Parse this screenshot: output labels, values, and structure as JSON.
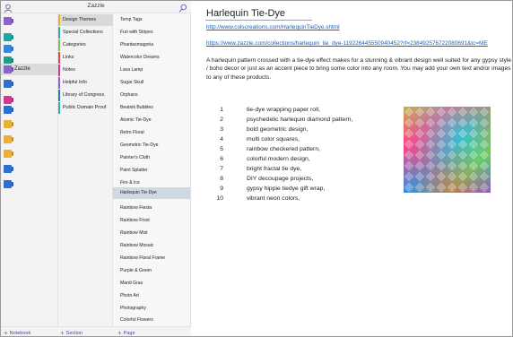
{
  "header": {
    "notebook_title": "Zazzle"
  },
  "colors": {
    "accent": "#7b51b5",
    "selected_page": "#cfd8e3"
  },
  "notebooks": [
    {
      "color": "#8b64c9",
      "label": ""
    },
    {
      "color": "#22a6a3",
      "label": ""
    },
    {
      "color": "#3a86d6",
      "label": ""
    },
    {
      "color": "#1f9e8c",
      "label": ""
    },
    {
      "color": "#8b64c9",
      "label": "Zazzle",
      "active": true
    },
    {
      "color": "#2f6fd0",
      "label": ""
    },
    {
      "color": "#d6368f",
      "label": ""
    },
    {
      "color": "#2f6fd0",
      "label": ""
    },
    {
      "color": "#e8b13a",
      "label": ""
    },
    {
      "color": "#e8b13a",
      "label": ""
    },
    {
      "color": "#e8b13a",
      "label": ""
    },
    {
      "color": "#2f6fd0",
      "label": ""
    },
    {
      "color": "#2f6fd0",
      "label": ""
    }
  ],
  "sections": [
    {
      "label": "Design Themes",
      "color": "#e8b13a",
      "active": true
    },
    {
      "label": "Special Collections",
      "color": "#2fb0a5"
    },
    {
      "label": "Categories",
      "color": "#7cc24a"
    },
    {
      "label": "Links",
      "color": "#e24444"
    },
    {
      "label": "Notes",
      "color": "#d6368f"
    },
    {
      "label": "Helpful Info",
      "color": "#8b64c9"
    },
    {
      "label": "Library of Congress",
      "color": "#2f6fd0"
    },
    {
      "label": "Public Domain Proof",
      "color": "#2fb0a5"
    }
  ],
  "pages": [
    {
      "label": "Temp Tags"
    },
    {
      "label": "Fun with Stripes"
    },
    {
      "label": "Phantasmagoria"
    },
    {
      "label": "Watercolor Dreams"
    },
    {
      "label": "Lava Lamp"
    },
    {
      "label": "Sugar Skull"
    },
    {
      "label": "Orphans"
    },
    {
      "label": "Beatnik Bubbles"
    },
    {
      "label": "Atomic Tie-Dye"
    },
    {
      "label": "Retro Floral"
    },
    {
      "label": "Geometric Tie-Dye"
    },
    {
      "label": "Painter's Cloth"
    },
    {
      "label": "Paint Splatter"
    },
    {
      "label": "Fire & Ice"
    },
    {
      "label": "Harlequin Tie-Dye",
      "active": true
    },
    {
      "label": "Rainbow Fiesta"
    },
    {
      "label": "Rainbow Frost"
    },
    {
      "label": "Rainbow Mist"
    },
    {
      "label": "Rainbow Mosaic"
    },
    {
      "label": "Rainbow Floral Frame"
    },
    {
      "label": "Purple & Green"
    },
    {
      "label": "Mardi Gras"
    },
    {
      "label": "Photo Art"
    },
    {
      "label": "Photography"
    },
    {
      "label": "Colorful Flowers"
    }
  ],
  "bottom": {
    "add_notebook": "Notebook",
    "add_section": "Section",
    "add_page": "Page"
  },
  "page": {
    "title": "Harlequin Tie-Dye",
    "link1": "http://www.colscreations.com/HarlequinTieDye.shtml",
    "link2": "https://www.zazzle.com/collections/harlequin_tie_dye-119226445550940452?rf=238492576722080691&tc=ME",
    "description": "A harlequin pattern crossed with a tie-dye effect makes for a stunning & vibrant design well suited for any gypsy style / boho decor or just as an accent piece to bring some color into any room. You may add your own text and/or images to any of these products.",
    "items": [
      {
        "num": "1",
        "text": "tie-dye wrapping paper roll,"
      },
      {
        "num": "2",
        "text": "psychedelic harlequin diamond pattern,"
      },
      {
        "num": "3",
        "text": "bold geometric design,"
      },
      {
        "num": "4",
        "text": "multi color squares,"
      },
      {
        "num": "5",
        "text": "rainbow checkered pattern,"
      },
      {
        "num": "6",
        "text": "colorful modern design,"
      },
      {
        "num": "7",
        "text": "bright fractal tie dye,"
      },
      {
        "num": "8",
        "text": "DIY decoupage projects,"
      },
      {
        "num": "9",
        "text": "gypsy hippie tiedye gift wrap,"
      },
      {
        "num": "10",
        "text": "vibrant neon colors,"
      }
    ]
  }
}
